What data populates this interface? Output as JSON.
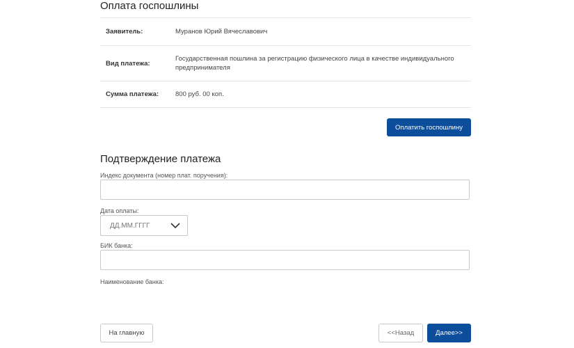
{
  "payment": {
    "title": "Оплата госпошлины",
    "rows": [
      {
        "label": "Заявитель:",
        "value": "Муранов Юрий Вячеславович"
      },
      {
        "label": "Вид платежа:",
        "value": "Государственная пошлина за регистрацию физического лица в качестве индивидуального предпринимателя"
      },
      {
        "label": "Сумма платежа:",
        "value": "800 руб. 00 коп."
      }
    ],
    "pay_button": "Оплатить госпошлину"
  },
  "confirmation": {
    "title": "Подтверждение платежа",
    "document_index_label": "Индекс документа (номер плат. поручения):",
    "document_index_value": "",
    "payment_date_label": "Дата оплаты:",
    "payment_date_placeholder": "ДД.ММ.ГГГГ",
    "bik_label": "БИК банка:",
    "bik_value": "",
    "bank_name_label": "Наименование банка:"
  },
  "footer": {
    "home_button": "На главную",
    "back_button": "<<Назад",
    "next_button": "Далее>>"
  },
  "colors": {
    "primary": "#0d4e9c",
    "border": "#c9c9c9"
  }
}
